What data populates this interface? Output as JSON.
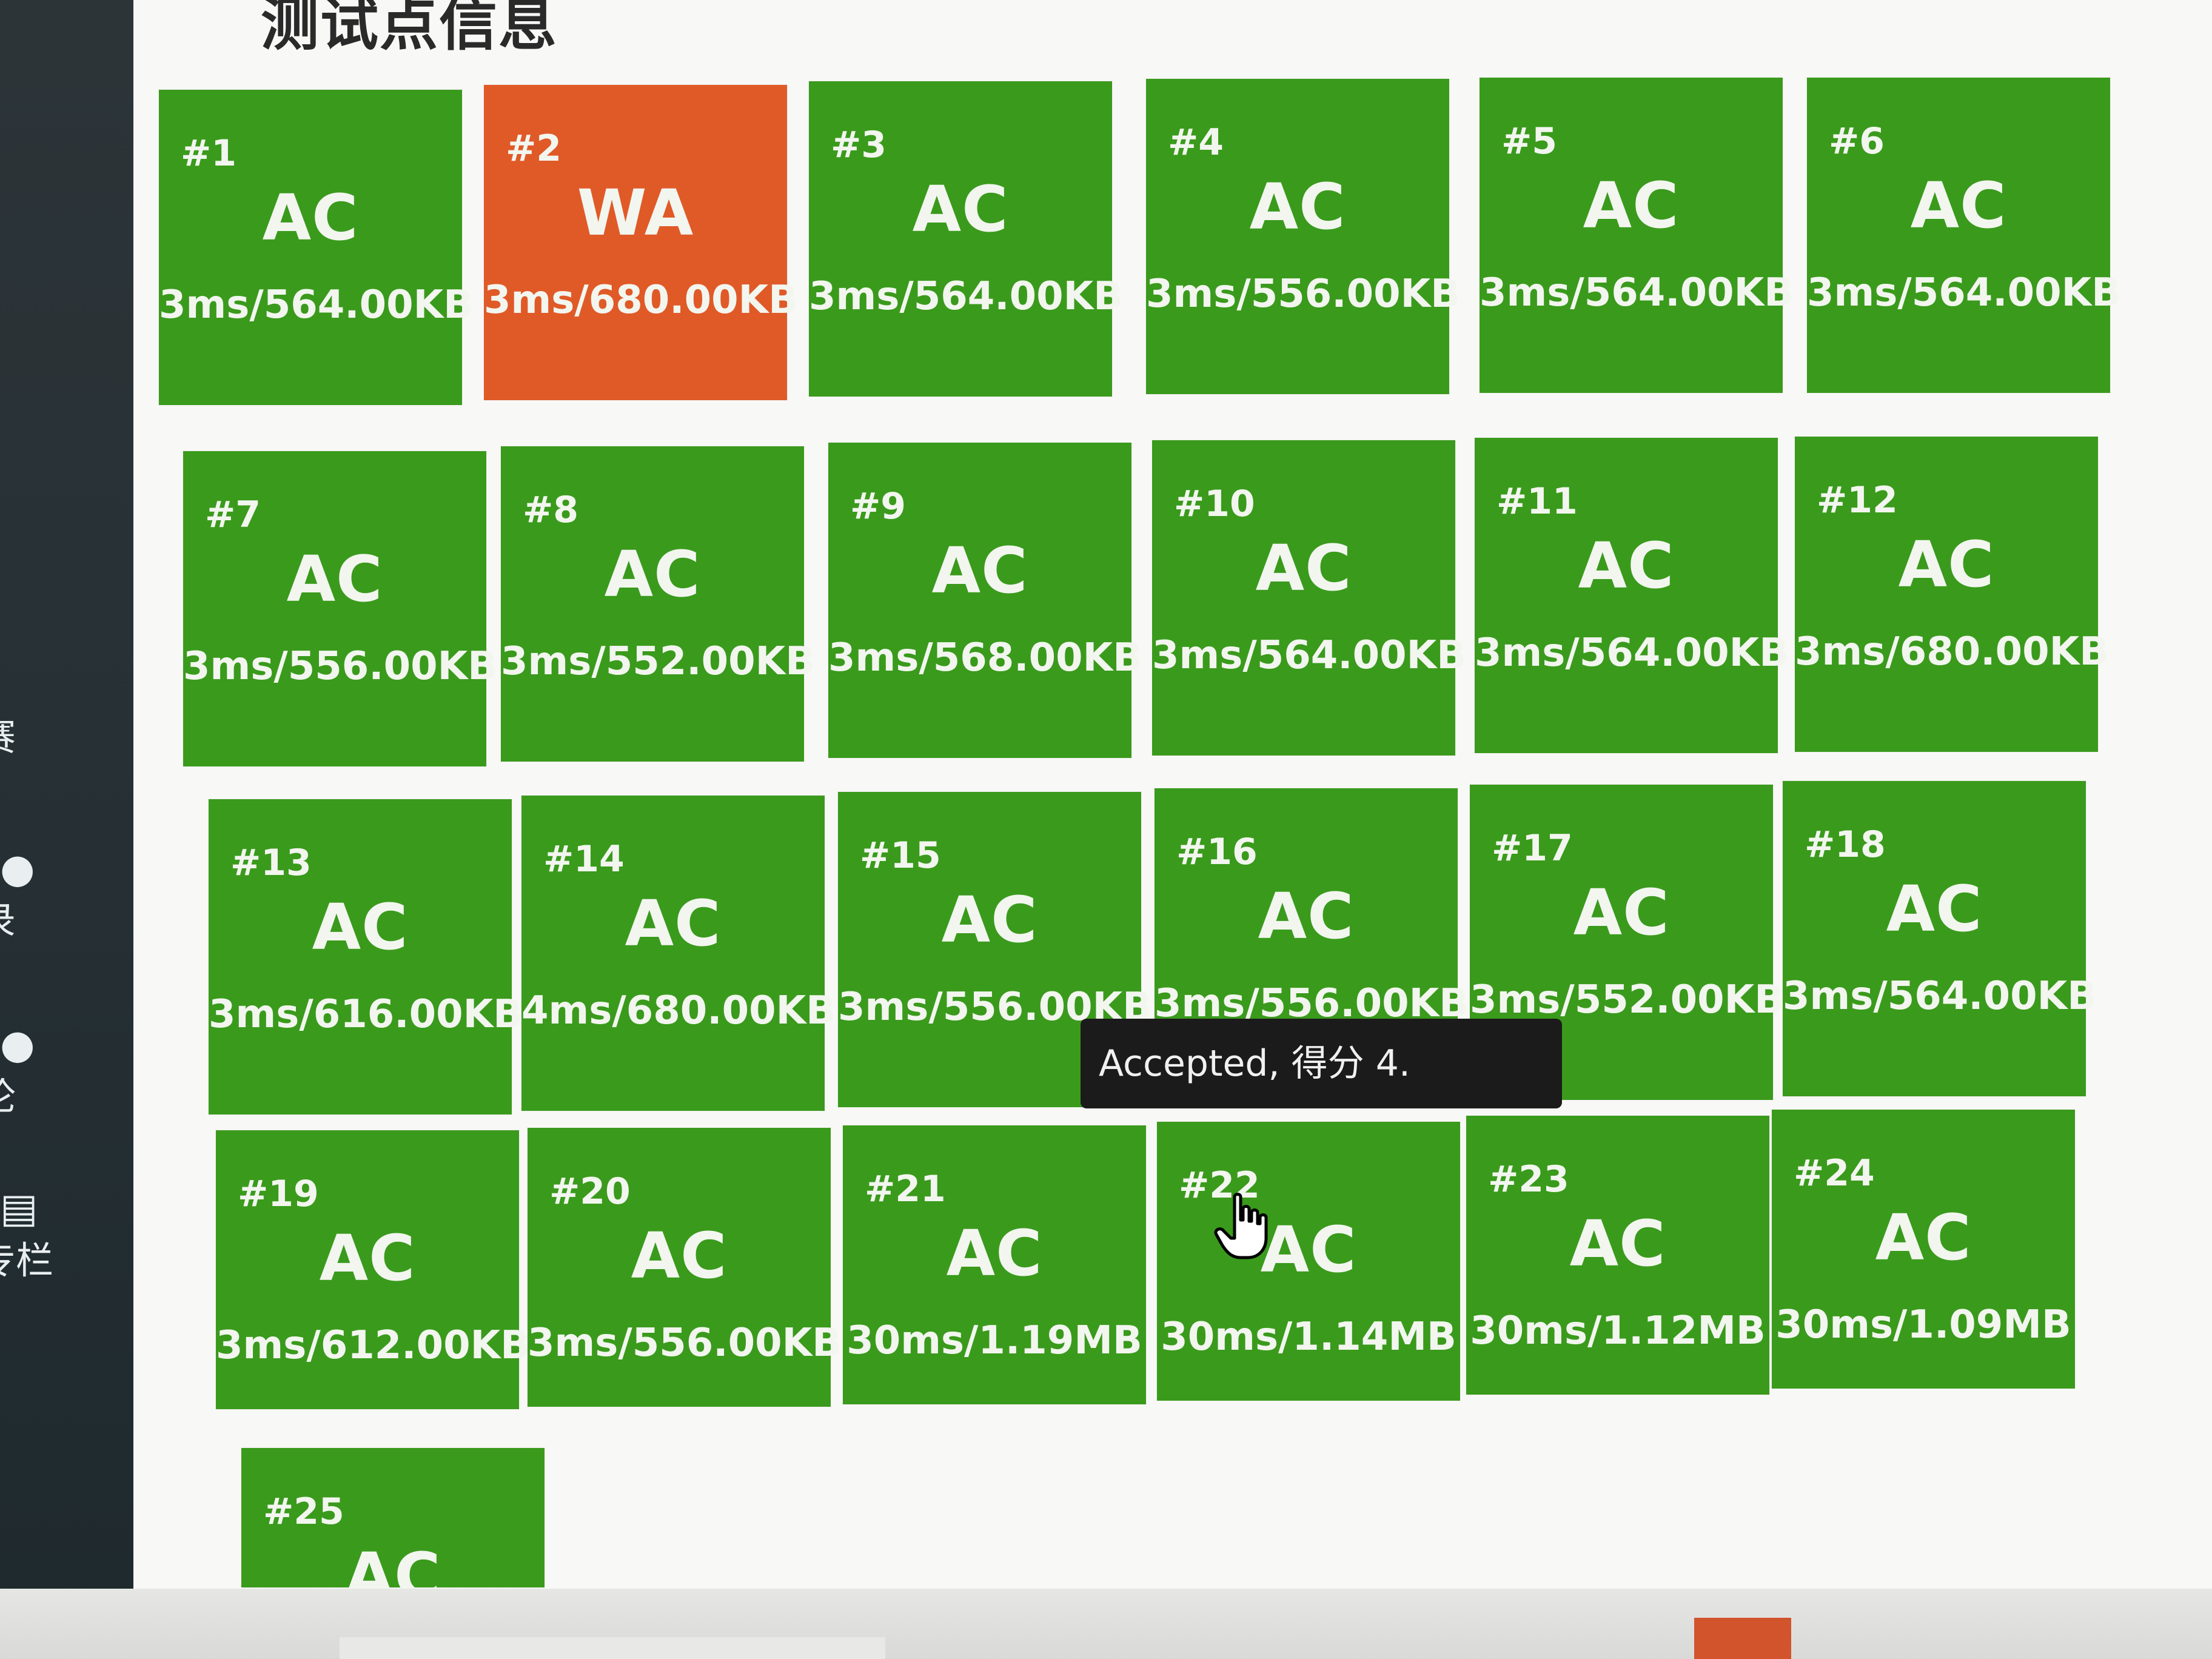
{
  "page": {
    "title": "测试点信息"
  },
  "sidebar": {
    "items": [
      {
        "label": "赛",
        "icon": "contest-icon"
      },
      {
        "label": "录",
        "icon": "record-icon"
      },
      {
        "label": "论",
        "icon": "discussion-icon"
      },
      {
        "label": "专栏",
        "icon": "column-icon"
      }
    ]
  },
  "testcases": [
    {
      "id": "#1",
      "status": "AC",
      "meta": "3ms/564.00KB"
    },
    {
      "id": "#2",
      "status": "WA",
      "meta": "3ms/680.00KB"
    },
    {
      "id": "#3",
      "status": "AC",
      "meta": "3ms/564.00KB"
    },
    {
      "id": "#4",
      "status": "AC",
      "meta": "3ms/556.00KB"
    },
    {
      "id": "#5",
      "status": "AC",
      "meta": "3ms/564.00KB"
    },
    {
      "id": "#6",
      "status": "AC",
      "meta": "3ms/564.00KB"
    },
    {
      "id": "#7",
      "status": "AC",
      "meta": "3ms/556.00KB"
    },
    {
      "id": "#8",
      "status": "AC",
      "meta": "3ms/552.00KB"
    },
    {
      "id": "#9",
      "status": "AC",
      "meta": "3ms/568.00KB"
    },
    {
      "id": "#10",
      "status": "AC",
      "meta": "3ms/564.00KB"
    },
    {
      "id": "#11",
      "status": "AC",
      "meta": "3ms/564.00KB"
    },
    {
      "id": "#12",
      "status": "AC",
      "meta": "3ms/680.00KB"
    },
    {
      "id": "#13",
      "status": "AC",
      "meta": "3ms/616.00KB"
    },
    {
      "id": "#14",
      "status": "AC",
      "meta": "4ms/680.00KB"
    },
    {
      "id": "#15",
      "status": "AC",
      "meta": "3ms/556.00KB"
    },
    {
      "id": "#16",
      "status": "AC",
      "meta": "3ms/556.00KB"
    },
    {
      "id": "#17",
      "status": "AC",
      "meta": "3ms/552.00KB"
    },
    {
      "id": "#18",
      "status": "AC",
      "meta": "3ms/564.00KB"
    },
    {
      "id": "#19",
      "status": "AC",
      "meta": "3ms/612.00KB"
    },
    {
      "id": "#20",
      "status": "AC",
      "meta": "3ms/556.00KB"
    },
    {
      "id": "#21",
      "status": "AC",
      "meta": "30ms/1.19MB"
    },
    {
      "id": "#22",
      "status": "AC",
      "meta": "30ms/1.14MB"
    },
    {
      "id": "#23",
      "status": "AC",
      "meta": "30ms/1.12MB"
    },
    {
      "id": "#24",
      "status": "AC",
      "meta": "30ms/1.09MB"
    },
    {
      "id": "#25",
      "status": "AC",
      "meta": ""
    }
  ],
  "tooltip": {
    "text": "Accepted, 得分 4."
  },
  "colors": {
    "ac": "#3a9a1c",
    "wa": "#e05a28",
    "tooltip_bg": "#1b1b1b",
    "sidebar_bg": "#2c3438"
  }
}
